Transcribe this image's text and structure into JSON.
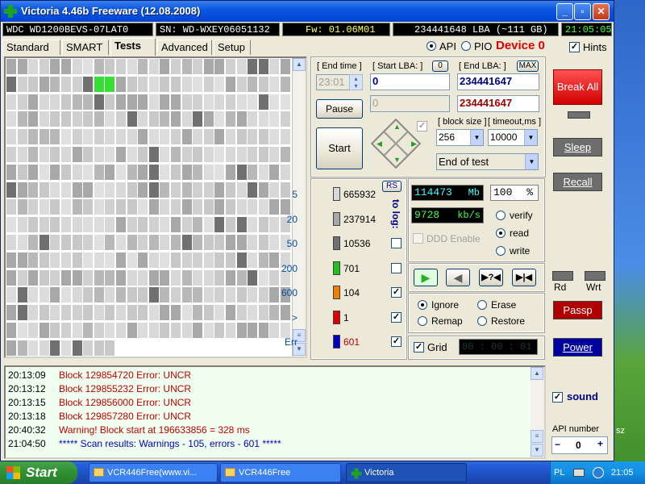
{
  "window": {
    "title": "Victoria 4.46b Freeware (12.08.2008)",
    "buttons": {
      "minimize": "_",
      "maximize": "▫",
      "close": "✕"
    }
  },
  "infobar": {
    "model": "WDC WD1200BEVS-07LAT0",
    "serial": "SN: WD-WXEY06051132",
    "firmware": "Fw: 01.06M01",
    "lba": "234441648 LBA (~111 GB)",
    "clock": "21:05:05"
  },
  "tabs": [
    "Standard",
    "SMART",
    "Tests",
    "Advanced",
    "Setup"
  ],
  "mode": {
    "api_label": "API",
    "pio_label": "PIO",
    "device_label": "Device 0",
    "hints_label": "Hints"
  },
  "test": {
    "end_time_label": "[ End time ]",
    "end_time_value": "23:01",
    "start_lba_label": "[ Start LBA: ]",
    "start_lba_zero": "0",
    "start_lba_value": "0",
    "start_lba_value2": "0",
    "end_lba_label": "[ End LBA: ]",
    "end_lba_max": "MAX",
    "end_lba_value": "234441647",
    "end_lba_value2": "234441647",
    "pause_label": "Pause",
    "start_label": "Start",
    "block_size_label": "[ block size ]",
    "block_size_value": "256",
    "timeout_label": "[ timeout,ms ]",
    "timeout_value": "10000",
    "end_action_value": "End of test"
  },
  "stats": {
    "rs_label": "RS",
    "to_log_label": "to log:",
    "rows": [
      {
        "label": "5",
        "count": "665932",
        "color": "#d8d8d8"
      },
      {
        "label": "20",
        "count": "237914",
        "color": "#a8a8a8"
      },
      {
        "label": "50",
        "count": "10536",
        "color": "#707070"
      },
      {
        "label": "200",
        "count": "701",
        "color": "#20c020"
      },
      {
        "label": "600",
        "count": "104",
        "color": "#f08000"
      },
      {
        "label": ">",
        "count": "1",
        "color": "#e00000"
      },
      {
        "label": "Err",
        "count": "601",
        "color": "#0000c0"
      }
    ]
  },
  "readout": {
    "mb_value": "114473",
    "mb_unit": "Mb",
    "percent_value": "100",
    "percent_unit": "%",
    "speed_value": "9728",
    "speed_unit": "kb/s",
    "ddd_label": "DDD Enable",
    "verify_label": "verify",
    "read_label": "read",
    "write_label": "write",
    "elapsed": "00 : 00 : 01",
    "grid_label": "Grid"
  },
  "actions": {
    "ignore_label": "Ignore",
    "erase_label": "Erase",
    "remap_label": "Remap",
    "restore_label": "Restore"
  },
  "side": {
    "break_all_label": "Break All",
    "sleep_label": "Sleep",
    "recall_label": "Recall",
    "rd_label": "Rd",
    "wrt_label": "Wrt",
    "passp_label": "Passp",
    "power_label": "Power",
    "sound_label": "sound",
    "api_number_label": "API number",
    "api_number_value": "0",
    "minus": "−",
    "plus": "+"
  },
  "log": [
    {
      "time": "20:13:09",
      "text": "Block 129854720 Error: UNCR",
      "color": "#c00000"
    },
    {
      "time": "20:13:12",
      "text": "Block 129855232 Error: UNCR",
      "color": "#c00000"
    },
    {
      "time": "20:13:15",
      "text": "Block 129856000 Error: UNCR",
      "color": "#c00000"
    },
    {
      "time": "20:13:18",
      "text": "Block 129857280 Error: UNCR",
      "color": "#c00000"
    },
    {
      "time": "20:40:32",
      "text": "Warning! Block start at 196633856 = 328 ms",
      "color": "#c00000"
    },
    {
      "time": "21:04:50",
      "text": "***** Scan results: Warnings - 105, errors - 601 *****",
      "color": "#0000c0"
    }
  ],
  "taskbar": {
    "start_label": "Start",
    "tasks": [
      "VCR446Free(www.vi...",
      "VCR446Free",
      "Victoria"
    ],
    "lang": "PL",
    "time": "21:05"
  },
  "desktop": {
    "partial_label": "sz"
  }
}
